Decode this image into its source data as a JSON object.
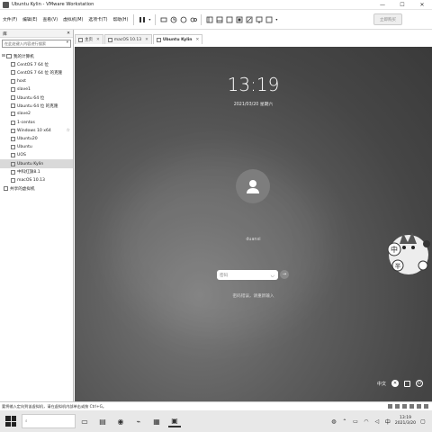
{
  "window": {
    "title": "Ubuntu Kylin - VMware Workstation"
  },
  "menu": [
    "文件(F)",
    "编辑(E)",
    "查看(V)",
    "虚拟机(M)",
    "选项卡(T)",
    "帮助(H)"
  ],
  "toolbar": {
    "upgrade_label": "立即购买"
  },
  "library": {
    "title": "库",
    "search_placeholder": "在此处键入内容进行搜索",
    "root_label": "我的计算机",
    "items": [
      "CentOS 7 64 位",
      "CentOS 7 64 位 的克隆",
      "host",
      "slave1",
      "Ubuntu 64 位",
      "Ubuntu 64 位 的克隆",
      "slave2",
      "1-centos",
      "Windows 10 x64",
      "Ubuntu20",
      "Ubuntu",
      "UOS",
      "Ubuntu Kylin",
      "中科红旗8.1",
      "macOS 10.13"
    ],
    "selected_index": 12,
    "shared_label": "共享的虚拟机"
  },
  "tabs": [
    {
      "label": "主页",
      "active": false
    },
    {
      "label": "macOS 10.13",
      "active": false
    },
    {
      "label": "Ubuntu Kylin",
      "active": true
    }
  ],
  "lockscreen": {
    "time": "13:19",
    "date": "2021/03/20 星期六",
    "username": "duanxi",
    "password_placeholder": "密码",
    "hint": "密码错误，请重新输入",
    "input_method": "中文"
  },
  "statusbar": {
    "text": "要将输入定向到该虚拟机，请在虚拟机内部单击或按 Ctrl+G。"
  },
  "taskbar": {
    "search_placeholder": "",
    "time": "13:19",
    "date": "2021/3/20",
    "ime": "中"
  }
}
